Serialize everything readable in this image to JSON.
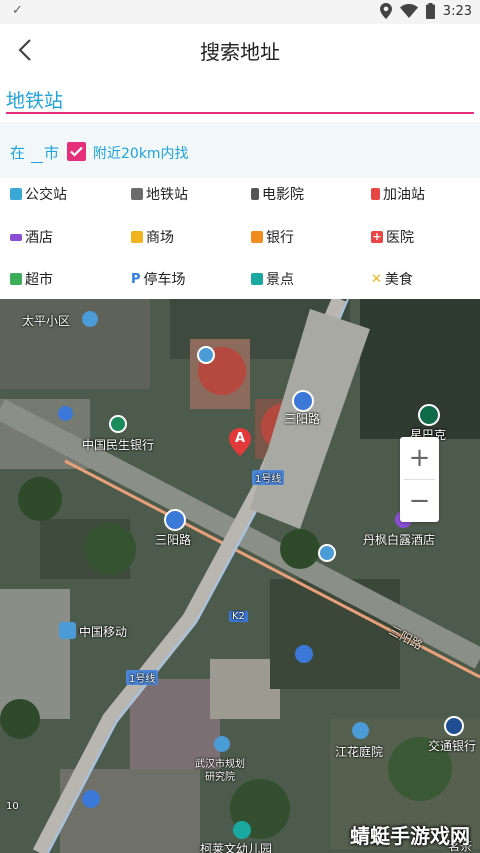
{
  "status_bar": {
    "time": "3:23",
    "icons": [
      "check-icon",
      "location-icon",
      "wifi-icon",
      "battery-icon"
    ]
  },
  "app_bar": {
    "title": "搜索地址",
    "back_icon": "back-arrow-icon"
  },
  "search": {
    "value": "地铁站"
  },
  "filter": {
    "prefix": "在",
    "city_value": "",
    "suffix": "市",
    "nearby_checked": true,
    "nearby_label": "附近20km内找"
  },
  "categories": [
    {
      "label": "公交站",
      "icon": "bus-icon",
      "color": "#3aa9d8"
    },
    {
      "label": "地铁站",
      "icon": "subway-icon",
      "color": "#6b6b6b"
    },
    {
      "label": "电影院",
      "icon": "film-icon",
      "color": "#555555"
    },
    {
      "label": "加油站",
      "icon": "gas-station-icon",
      "color": "#e84545"
    },
    {
      "label": "酒店",
      "icon": "bed-icon",
      "color": "#8a4fd3"
    },
    {
      "label": "商场",
      "icon": "shopping-bag-icon",
      "color": "#f0b51e"
    },
    {
      "label": "银行",
      "icon": "bank-icon",
      "color": "#f08c1e"
    },
    {
      "label": "医院",
      "icon": "hospital-icon",
      "color": "#e84545"
    },
    {
      "label": "超市",
      "icon": "cart-icon",
      "color": "#3cae5a"
    },
    {
      "label": "停车场",
      "icon": "parking-icon",
      "color": "#2f7fe0"
    },
    {
      "label": "景点",
      "icon": "camera-icon",
      "color": "#1aa9a0"
    },
    {
      "label": "美食",
      "icon": "food-icon",
      "color": "#f0b51e"
    }
  ],
  "map": {
    "labels": {
      "taiping": "太平小区",
      "minsheng": "中国民生银行",
      "sanyang_top": "三阳路",
      "line1_a": "1号线",
      "xingbake": "星巴克",
      "sanyang_mid": "三阳路",
      "danfeng": "丹枫白露酒店",
      "k2": "K2",
      "yidong": "中国移动",
      "sanyang_road": "三阳路",
      "line1_b": "1号线",
      "guihua_1": "武汉市规划",
      "guihua_2": "研究院",
      "jianghua": "江花庭院",
      "jiaotong": "交通银行",
      "kelai": "柯莱文幼儿园",
      "mingcha": "茗茶",
      "marker": "A",
      "scale": "10"
    },
    "zoom_in": "+",
    "zoom_out": "−",
    "watermark": "蜻蜓手游戏网"
  }
}
